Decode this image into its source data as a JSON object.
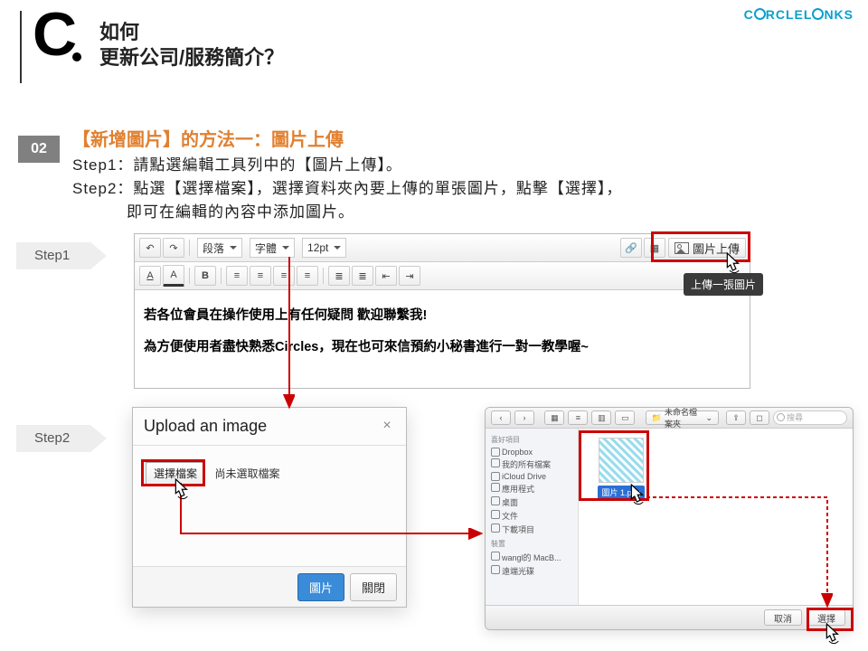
{
  "logo_text": "CIRCLELINKS",
  "section_letter": "C",
  "title_line1": "如何",
  "title_line2": "更新公司/服務簡介？",
  "badge": "02",
  "subtitle": "【新增圖片】的方法一：圖片上傳",
  "step1_text": "Step1：請點選編輯工具列中的【圖片上傳】。",
  "step2_text": "Step2：點選【選擇檔案】，選擇資料夾內要上傳的單張圖片，點擊【選擇】，",
  "step2_cont": "即可在編輯的內容中添加圖片。",
  "chevrons": {
    "step1": "Step1",
    "step2": "Step2"
  },
  "editor": {
    "selects": {
      "paragraph": "段落",
      "font": "字體",
      "size": "12pt"
    },
    "upload_label": "圖片上傳",
    "tooltip": "上傳一張圖片",
    "content_line1": "若各位會員在操作使用上有任何疑問 歡迎聯繫我!",
    "content_line2": "為方便使用者盡快熟悉Circles，現在也可來信預約小秘書進行一對一教學喔~"
  },
  "modal": {
    "title": "Upload an image",
    "choose": "選擇檔案",
    "nofile": "尚未選取檔案",
    "primary": "圖片",
    "secondary": "關閉"
  },
  "finder": {
    "folder_dropdown": "未命名檔案夾",
    "search_placeholder": "搜尋",
    "side": {
      "hdr1": "喜好項目",
      "items1": [
        "Dropbox",
        "我的所有檔案",
        "iCloud Drive",
        "應用程式",
        "桌面",
        "文件",
        "下載項目"
      ],
      "hdr2": "裝置",
      "items2": [
        "wangl的 MacB...",
        "遠端光碟"
      ]
    },
    "thumb_label": "圖片 1.png",
    "cancel": "取消",
    "select": "選擇"
  }
}
